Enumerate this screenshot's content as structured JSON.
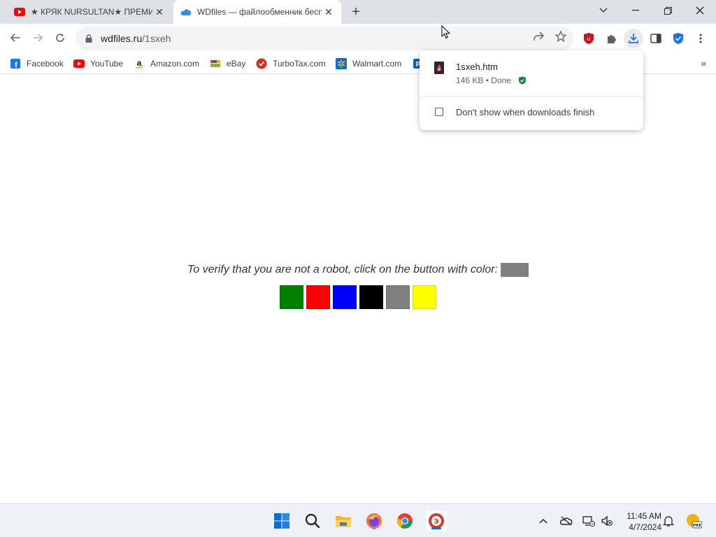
{
  "tabs": [
    {
      "title": "★ КРЯК NURSULTAN★ ПРЕМИУМ",
      "close": "✕"
    },
    {
      "title": "WDfiles — файлообменник бесплатный",
      "close": "✕"
    }
  ],
  "new_tab": "+",
  "address": {
    "host": "wdfiles.ru",
    "path": "/1sxeh"
  },
  "bookmarks": [
    {
      "label": "Facebook"
    },
    {
      "label": "YouTube"
    },
    {
      "label": "Amazon.com"
    },
    {
      "label": "eBay"
    },
    {
      "label": "TurboTax.com"
    },
    {
      "label": "Walmart.com"
    }
  ],
  "bookmarks_overflow": "»",
  "download": {
    "filename": "1sxeh.htm",
    "status": "146 KB • Done",
    "option_label": "Don't show when downloads finish"
  },
  "captcha": {
    "prompt": "To verify that you are not a robot, click on the button with color:",
    "target_color": "#808080",
    "buttons": [
      {
        "color": "#008000",
        "name": "green"
      },
      {
        "color": "#ff0000",
        "name": "red"
      },
      {
        "color": "#0000ff",
        "name": "blue"
      },
      {
        "color": "#000000",
        "name": "black"
      },
      {
        "color": "#808080",
        "name": "gray"
      },
      {
        "color": "#ffff00",
        "name": "yellow"
      }
    ]
  },
  "taskbar": {
    "time": "11:45 AM",
    "date": "4/7/2024"
  },
  "colors": {
    "accent": "#1a73e8",
    "tabstrip": "#dee1e6",
    "taskbar": "#eef1f5"
  }
}
